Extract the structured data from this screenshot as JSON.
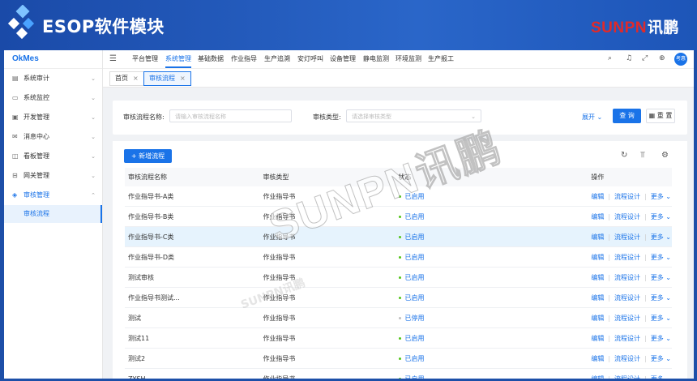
{
  "banner": {
    "title": "ESOP软件模块",
    "brand_en": "SUNPN",
    "brand_cn": "讯鹏"
  },
  "sidebar": {
    "app_name": "OkMes",
    "items": [
      {
        "label": "系统审计",
        "icon": "audit-icon"
      },
      {
        "label": "系统监控",
        "icon": "monitor-icon"
      },
      {
        "label": "开发管理",
        "icon": "dev-icon"
      },
      {
        "label": "消息中心",
        "icon": "message-icon"
      },
      {
        "label": "看板管理",
        "icon": "board-icon"
      },
      {
        "label": "网关管理",
        "icon": "gateway-icon"
      },
      {
        "label": "审核管理",
        "icon": "review-icon"
      }
    ],
    "sub_item": "审核流程"
  },
  "topnav": {
    "items": [
      "平台管理",
      "系统管理",
      "基础数据",
      "作业指导",
      "生产追溯",
      "安灯呼叫",
      "设备管理",
      "静电监测",
      "环境监测",
      "生产报工"
    ],
    "active_index": 1,
    "avatar": "考惠"
  },
  "tabs": [
    {
      "label": "首页",
      "close": "×"
    },
    {
      "label": "审核流程",
      "close": "×"
    }
  ],
  "search": {
    "name_label": "审核流程名称:",
    "name_placeholder": "请输入审核流程名称",
    "type_label": "审核类型:",
    "type_placeholder": "请选择审核类型",
    "expand": "展开",
    "query": "查 询",
    "reset": "重 置"
  },
  "table": {
    "add_button": "新增流程",
    "headers": [
      "审核流程名称",
      "审核类型",
      "状态",
      "操作"
    ],
    "rows": [
      {
        "name": "作业指导书-A类",
        "type": "作业指导书",
        "status": "已启用",
        "status_color": "#52c41a"
      },
      {
        "name": "作业指导书-B类",
        "type": "作业指导书",
        "status": "已启用",
        "status_color": "#52c41a"
      },
      {
        "name": "作业指导书-C类",
        "type": "作业指导书",
        "status": "已启用",
        "status_color": "#52c41a"
      },
      {
        "name": "作业指导书-D类",
        "type": "作业指导书",
        "status": "已启用",
        "status_color": "#52c41a"
      },
      {
        "name": "测试审核",
        "type": "作业指导书",
        "status": "已启用",
        "status_color": "#52c41a"
      },
      {
        "name": "作业指导书测试...",
        "type": "作业指导书",
        "status": "已启用",
        "status_color": "#52c41a"
      },
      {
        "name": "测试",
        "type": "作业指导书",
        "status": "已停用",
        "status_color": "#bfbfbf"
      },
      {
        "name": "测试11",
        "type": "作业指导书",
        "status": "已启用",
        "status_color": "#52c41a"
      },
      {
        "name": "测试2",
        "type": "作业指导书",
        "status": "已启用",
        "status_color": "#52c41a"
      },
      {
        "name": "ZYSH",
        "type": "作业指导书",
        "status": "已启用",
        "status_color": "#52c41a"
      }
    ],
    "actions": {
      "edit": "编辑",
      "design": "流程设计",
      "more": "更多"
    }
  },
  "watermark": "SUNPN讯鹏"
}
